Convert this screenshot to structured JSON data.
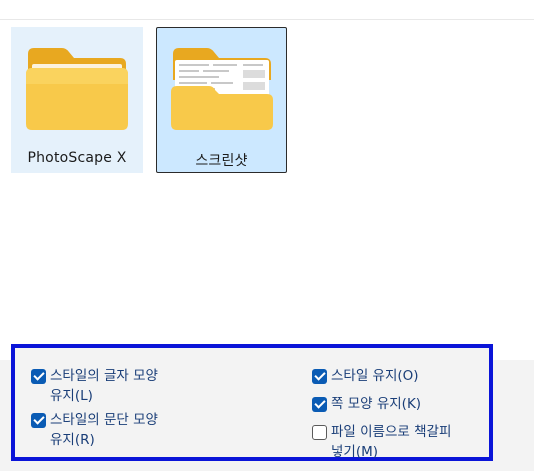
{
  "folders": [
    {
      "name": "PhotoScape X"
    },
    {
      "name": "스크린샷"
    }
  ],
  "options": {
    "left": [
      {
        "label": "스타일의 글자 모양\n유지(L)",
        "checked": true
      },
      {
        "label": "스타일의 문단 모양\n유지(R)",
        "checked": true
      }
    ],
    "right": [
      {
        "label": "스타일 유지(O)",
        "checked": true
      },
      {
        "label": "쪽 모양 유지(K)",
        "checked": true
      },
      {
        "label": "파일 이름으로 책갈피\n넣기(M)",
        "checked": false
      }
    ]
  },
  "colors": {
    "highlight_border": "#0a14d8",
    "checkbox_checked": "#0a5bb4",
    "label_text": "#1a3e78",
    "folder_yellow": "#f8c94a"
  }
}
